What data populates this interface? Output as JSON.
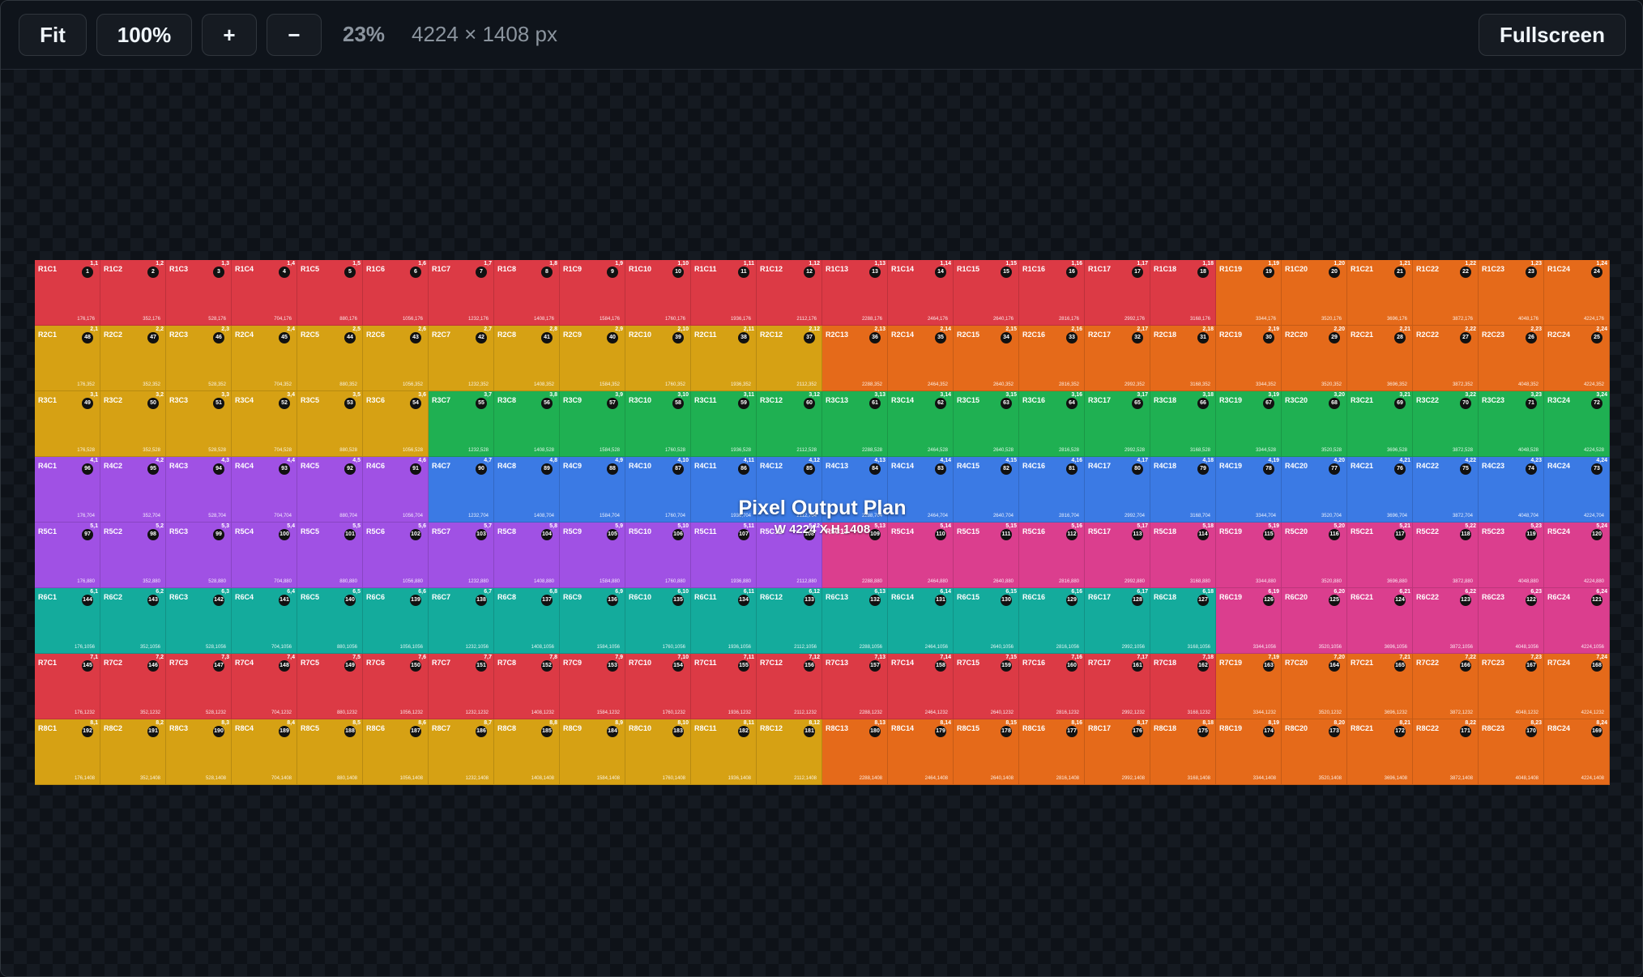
{
  "toolbar": {
    "fit_label": "Fit",
    "actual_size_label": "100%",
    "zoom_in_label": "+",
    "zoom_out_label": "−",
    "zoom_level": "23%",
    "dimensions": "4224 × 1408 px",
    "fullscreen_label": "Fullscreen"
  },
  "plan": {
    "title": "Pixel Output Plan",
    "subtitle": "W 4224 X H 1408",
    "rows": 8,
    "cols": 24,
    "tile_width": 176,
    "tile_height": 176
  },
  "colors": {
    "red": "#dc3a45",
    "orange": "#e56a1a",
    "yellow": "#d6a114",
    "green": "#1fb052",
    "blue": "#3b7ae4",
    "purple": "#a051e4",
    "pink": "#db3e8e",
    "teal": "#14ab9c"
  },
  "row_color_runs": [
    [
      [
        "red",
        18
      ],
      [
        "orange",
        6
      ]
    ],
    [
      [
        "yellow",
        12
      ],
      [
        "orange",
        12
      ]
    ],
    [
      [
        "yellow",
        6
      ],
      [
        "green",
        18
      ]
    ],
    [
      [
        "purple",
        6
      ],
      [
        "blue",
        18
      ]
    ],
    [
      [
        "purple",
        12
      ],
      [
        "pink",
        12
      ]
    ],
    [
      [
        "teal",
        18
      ],
      [
        "pink",
        6
      ]
    ],
    [
      [
        "red",
        18
      ],
      [
        "orange",
        6
      ]
    ],
    [
      [
        "yellow",
        12
      ],
      [
        "orange",
        12
      ]
    ]
  ]
}
